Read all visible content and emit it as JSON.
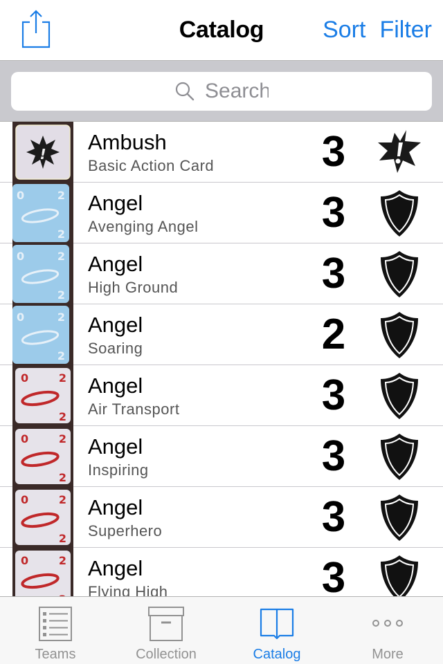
{
  "navbar": {
    "title": "Catalog",
    "share_icon": "share-icon",
    "sort_label": "Sort",
    "filter_label": "Filter"
  },
  "search": {
    "placeholder": "Search",
    "value": "",
    "icon": "search-icon"
  },
  "colors": {
    "accent": "#1a7de6",
    "inactive_tab": "#929292",
    "searchbar_bg": "#c9c9ce",
    "subtitle": "#555555"
  },
  "list": {
    "rows": [
      {
        "title": "Ambush",
        "subtitle": "Basic Action Card",
        "count": "3",
        "thumb": "action-card-thumb",
        "type_icon": "explosion-icon"
      },
      {
        "title": "Angel",
        "subtitle": "Avenging Angel",
        "count": "3",
        "thumb": "blue-angel-tile-thumb",
        "type_icon": "shield-icon"
      },
      {
        "title": "Angel",
        "subtitle": "High Ground",
        "count": "3",
        "thumb": "blue-angel-tile-thumb",
        "type_icon": "shield-icon"
      },
      {
        "title": "Angel",
        "subtitle": "Soaring",
        "count": "2",
        "thumb": "blue-angel-tile-thumb",
        "type_icon": "shield-icon"
      },
      {
        "title": "Angel",
        "subtitle": "Air Transport",
        "count": "3",
        "thumb": "red-angel-tile-thumb",
        "type_icon": "shield-icon"
      },
      {
        "title": "Angel",
        "subtitle": "Inspiring",
        "count": "3",
        "thumb": "red-angel-tile-thumb",
        "type_icon": "shield-icon"
      },
      {
        "title": "Angel",
        "subtitle": "Superhero",
        "count": "3",
        "thumb": "red-angel-tile-thumb",
        "type_icon": "shield-icon"
      },
      {
        "title": "Angel",
        "subtitle": "Flying High",
        "count": "3",
        "thumb": "red-angel-tile-thumb",
        "type_icon": "shield-icon"
      }
    ],
    "tile_numbers": {
      "top_left": "0",
      "top_right": "2",
      "bottom_right": "2"
    }
  },
  "tabbar": {
    "tabs": [
      {
        "label": "Teams",
        "icon": "list-icon",
        "active": false
      },
      {
        "label": "Collection",
        "icon": "archive-box-icon",
        "active": false
      },
      {
        "label": "Catalog",
        "icon": "book-icon",
        "active": true
      },
      {
        "label": "More",
        "icon": "more-dots-icon",
        "active": false
      }
    ]
  }
}
